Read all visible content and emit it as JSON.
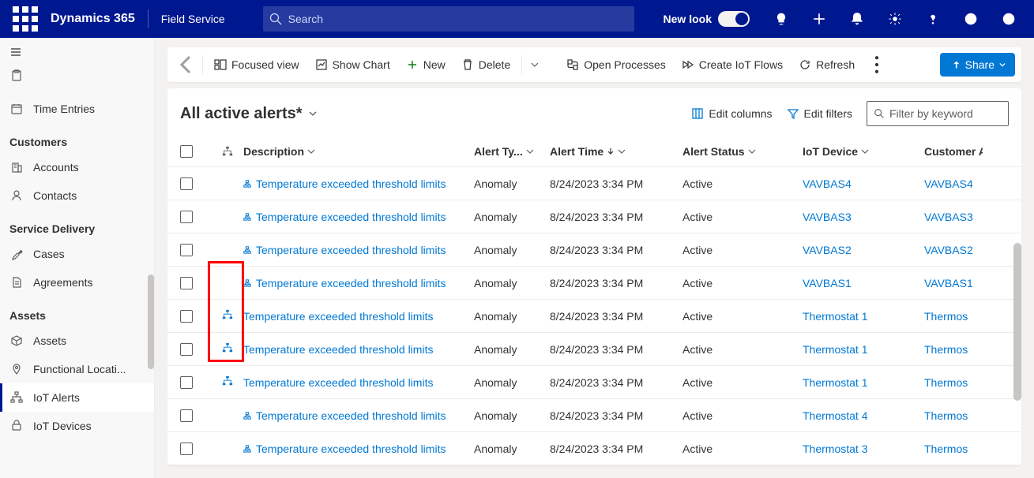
{
  "topbar": {
    "brand": "Dynamics 365",
    "app": "Field Service",
    "search_placeholder": "Search",
    "newlook": "New look"
  },
  "commands": {
    "focused_view": "Focused view",
    "show_chart": "Show Chart",
    "new": "New",
    "delete": "Delete",
    "open_processes": "Open Processes",
    "create_iot_flows": "Create IoT Flows",
    "refresh": "Refresh",
    "share": "Share"
  },
  "view": {
    "title": "All active alerts*",
    "edit_columns": "Edit columns",
    "edit_filters": "Edit filters",
    "filter_placeholder": "Filter by keyword"
  },
  "sidebar": {
    "item_cut": "...",
    "time_entries": "Time Entries",
    "group_customers": "Customers",
    "accounts": "Accounts",
    "contacts": "Contacts",
    "group_service": "Service Delivery",
    "cases": "Cases",
    "agreements": "Agreements",
    "group_assets": "Assets",
    "assets": "Assets",
    "functional_loc": "Functional Locati...",
    "iot_alerts": "IoT Alerts",
    "iot_devices": "IoT Devices"
  },
  "columns": {
    "description": "Description",
    "alert_type": "Alert Ty...",
    "alert_time": "Alert Time",
    "alert_status": "Alert Status",
    "iot_device": "IoT Device",
    "customer": "Customer A"
  },
  "rows": [
    {
      "hier": "small",
      "desc": "Temperature exceeded threshold limits",
      "type": "Anomaly",
      "time": "8/24/2023 3:34 PM",
      "status": "Active",
      "device": "VAVBAS4",
      "cust": "VAVBAS4"
    },
    {
      "hier": "small",
      "desc": "Temperature exceeded threshold limits",
      "type": "Anomaly",
      "time": "8/24/2023 3:34 PM",
      "status": "Active",
      "device": "VAVBAS3",
      "cust": "VAVBAS3"
    },
    {
      "hier": "small",
      "desc": "Temperature exceeded threshold limits",
      "type": "Anomaly",
      "time": "8/24/2023 3:34 PM",
      "status": "Active",
      "device": "VAVBAS2",
      "cust": "VAVBAS2"
    },
    {
      "hier": "small",
      "desc": "Temperature exceeded threshold limits",
      "type": "Anomaly",
      "time": "8/24/2023 3:34 PM",
      "status": "Active",
      "device": "VAVBAS1",
      "cust": "VAVBAS1"
    },
    {
      "hier": "big",
      "desc": "Temperature exceeded threshold limits",
      "type": "Anomaly",
      "time": "8/24/2023 3:34 PM",
      "status": "Active",
      "device": "Thermostat 1",
      "cust": "Thermos"
    },
    {
      "hier": "big",
      "desc": "Temperature exceeded threshold limits",
      "type": "Anomaly",
      "time": "8/24/2023 3:34 PM",
      "status": "Active",
      "device": "Thermostat 1",
      "cust": "Thermos"
    },
    {
      "hier": "big",
      "desc": "Temperature exceeded threshold limits",
      "type": "Anomaly",
      "time": "8/24/2023 3:34 PM",
      "status": "Active",
      "device": "Thermostat 1",
      "cust": "Thermos"
    },
    {
      "hier": "small",
      "desc": "Temperature exceeded threshold limits",
      "type": "Anomaly",
      "time": "8/24/2023 3:34 PM",
      "status": "Active",
      "device": "Thermostat 4",
      "cust": "Thermos"
    },
    {
      "hier": "small",
      "desc": "Temperature exceeded threshold limits",
      "type": "Anomaly",
      "time": "8/24/2023 3:34 PM",
      "status": "Active",
      "device": "Thermostat 3",
      "cust": "Thermos"
    }
  ]
}
